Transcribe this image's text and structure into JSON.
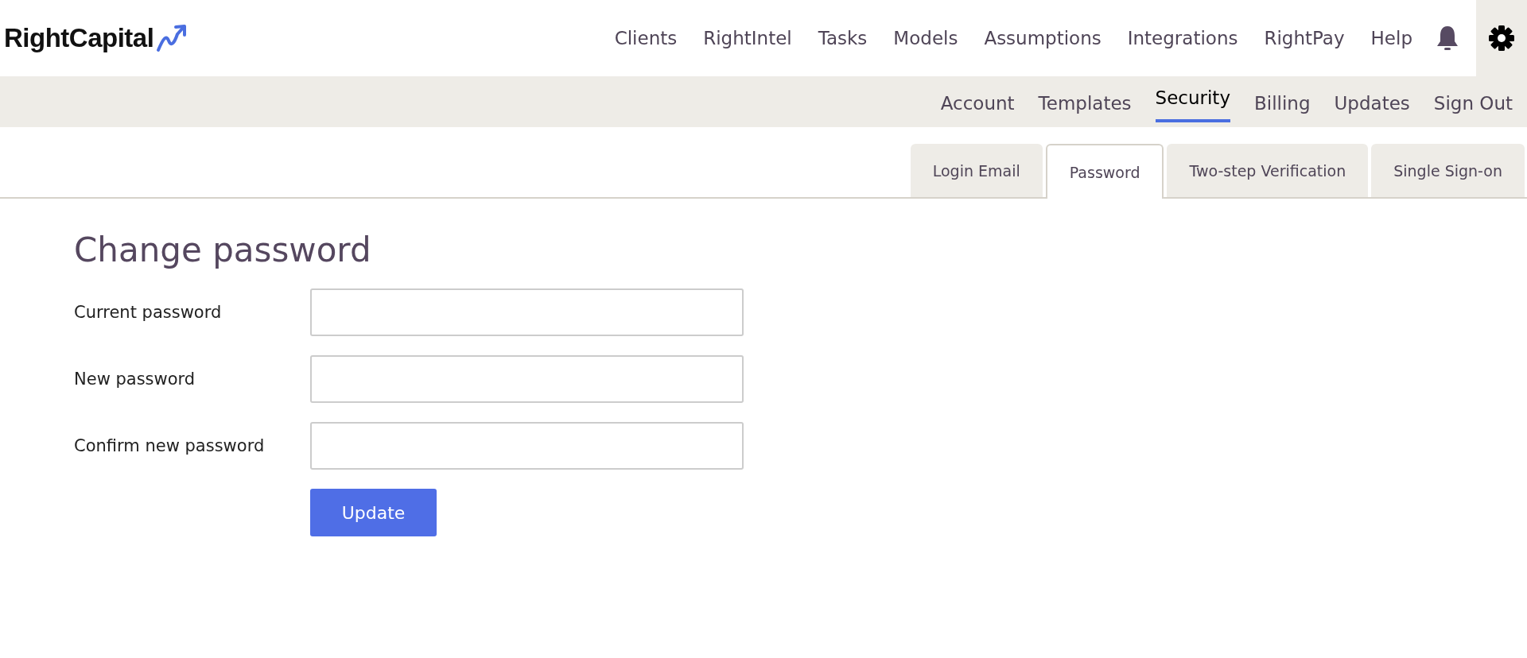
{
  "logo": {
    "text": "RightCapital"
  },
  "main_nav": [
    {
      "label": "Clients",
      "selected": false
    },
    {
      "label": "RightIntel",
      "selected": false
    },
    {
      "label": "Tasks",
      "selected": false
    },
    {
      "label": "Models",
      "selected": false
    },
    {
      "label": "Assumptions",
      "selected": false
    },
    {
      "label": "Integrations",
      "selected": false
    },
    {
      "label": "RightPay",
      "selected": false
    },
    {
      "label": "Help",
      "selected": false
    }
  ],
  "nav_icons": [
    {
      "kind": "bell",
      "selected": false
    },
    {
      "kind": "gear",
      "selected": true
    }
  ],
  "sub_nav": [
    {
      "label": "Account",
      "selected": false
    },
    {
      "label": "Templates",
      "selected": false
    },
    {
      "label": "Security",
      "selected": true
    },
    {
      "label": "Billing",
      "selected": false
    },
    {
      "label": "Updates",
      "selected": false
    },
    {
      "label": "Sign Out",
      "selected": false
    }
  ],
  "tabs": [
    {
      "label": "Login Email",
      "selected": false
    },
    {
      "label": "Password",
      "selected": true
    },
    {
      "label": "Two-step Verification",
      "selected": false
    },
    {
      "label": "Single Sign-on",
      "selected": false
    }
  ],
  "form": {
    "title": "Change password",
    "fields": [
      {
        "label": "Current password"
      },
      {
        "label": "New password"
      },
      {
        "label": "Confirm new password"
      }
    ],
    "submit": "Update"
  }
}
